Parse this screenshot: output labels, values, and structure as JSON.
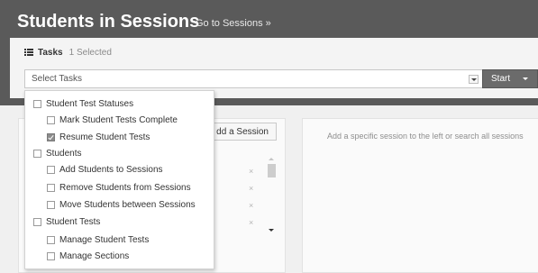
{
  "header": {
    "title": "Students in Sessions",
    "goto_link": "Go to Sessions »"
  },
  "tasks": {
    "label": "Tasks",
    "selected_count": "1 Selected",
    "select_placeholder": "Select Tasks",
    "start_label": "Start"
  },
  "left_panel": {
    "add_session_label": "dd a Session",
    "remove_icon": "×"
  },
  "right_panel": {
    "hint": "Add a specific session to the left or search all sessions"
  },
  "dropdown": {
    "items": [
      {
        "label": "Student Test Statuses",
        "level": "group",
        "checked": false
      },
      {
        "label": "Mark Student Tests Complete",
        "level": "sub",
        "checked": false
      },
      {
        "label": "Resume Student Tests",
        "level": "sub",
        "checked": true
      },
      {
        "label": "Students",
        "level": "group",
        "checked": false
      },
      {
        "label": "Add Students to Sessions",
        "level": "sub",
        "checked": false
      },
      {
        "label": "Remove Students from Sessions",
        "level": "sub",
        "checked": false
      },
      {
        "label": "Move Students between Sessions",
        "level": "sub",
        "checked": false
      },
      {
        "label": "Student Tests",
        "level": "group",
        "checked": false
      },
      {
        "label": "Manage Student Tests",
        "level": "sub",
        "checked": false
      },
      {
        "label": "Manage Sections",
        "level": "sub",
        "checked": false
      }
    ]
  },
  "colors": {
    "header_bg": "#5a5a5a",
    "start_button": "#6b6b6b",
    "checked_box": "#8c8c8c"
  },
  "icons": [
    "tasks-list-icon",
    "dropdown-arrow-icon",
    "caret-down-icon",
    "remove-x-icon",
    "checkbox-icon"
  ]
}
